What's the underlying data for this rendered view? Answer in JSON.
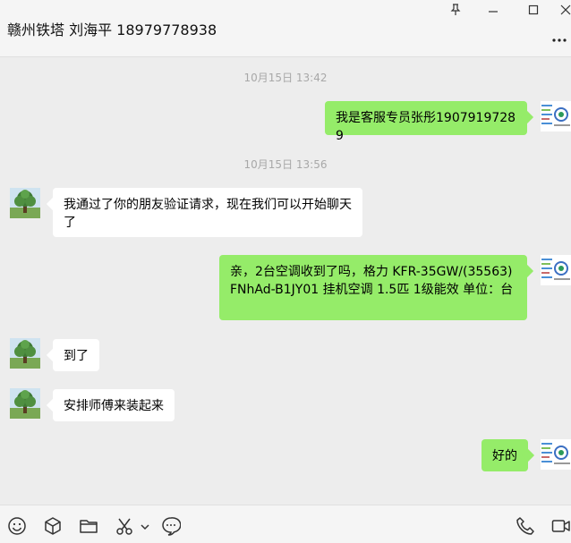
{
  "header": {
    "title": "赣州铁塔 刘海平 18979778938",
    "window_controls": [
      "pin-icon",
      "minimize-icon",
      "maximize-icon",
      "close-icon"
    ],
    "more_icon": "more-dots-icon"
  },
  "messages": [
    {
      "type": "time",
      "text": "10月15日 13:42"
    },
    {
      "type": "out",
      "text": "我是客服专员张彤19079197289"
    },
    {
      "type": "time",
      "text": "10月15日 13:56"
    },
    {
      "type": "in",
      "text": "我通过了你的朋友验证请求，现在我们可以开始聊天了"
    },
    {
      "type": "out",
      "text": "亲，2台空调收到了吗，格力 KFR-35GW/(35563)FNhAd-B1JY01 挂机空调 1.5匹 1级能效 单位：台"
    },
    {
      "type": "in",
      "text": "到了"
    },
    {
      "type": "in",
      "text": "安排师傅来装起来"
    },
    {
      "type": "out",
      "text": "好的"
    }
  ],
  "toolbar": {
    "icons": [
      "emoji-icon",
      "package-icon",
      "folder-icon",
      "scissors-icon",
      "dropdown-icon",
      "chat-bubble-icon",
      "phone-icon",
      "video-icon"
    ]
  },
  "colors": {
    "chat_bg": "#ededed",
    "out_bubble": "#95ec69",
    "in_bubble": "#ffffff",
    "timestamp": "#a8a8a8"
  }
}
